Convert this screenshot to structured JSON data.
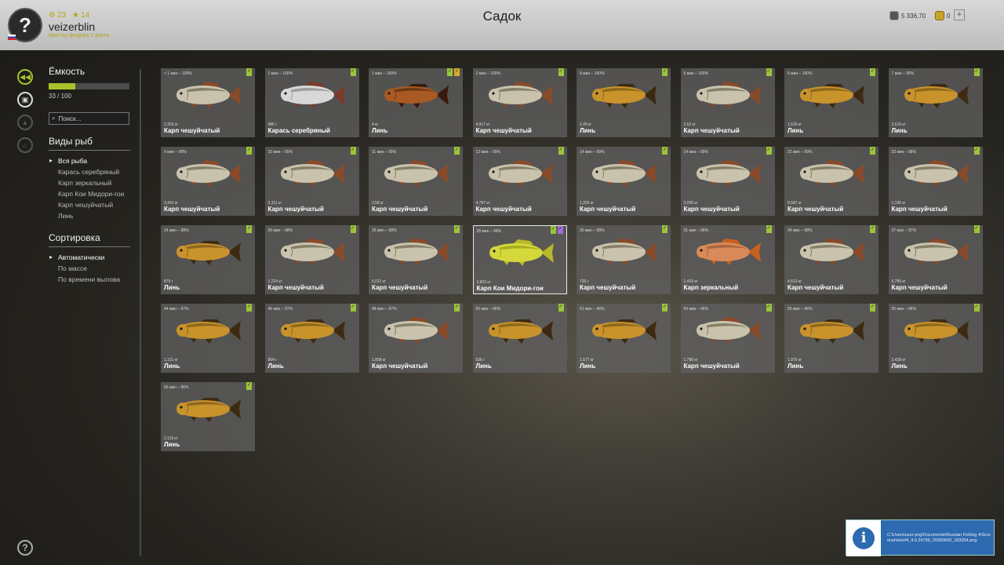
{
  "header": {
    "title": "Садок",
    "player": {
      "avatar_glyph": "?",
      "username": "veizerblin",
      "rank": "Мастер фидера 2 ранга",
      "stat1": "23",
      "stat2": "14"
    },
    "money": "5 336,70",
    "gold": "0",
    "plus_label": "+"
  },
  "rail_icons": [
    "keepnet-icon",
    "backpack-icon",
    "fire-icon",
    "home-icon"
  ],
  "sidebar": {
    "capacity_title": "Ёмкость",
    "capacity_text": "33 / 100",
    "capacity_fraction": 0.33,
    "search_placeholder": "Поиск...",
    "fish_types_title": "Виды рыб",
    "fish_types": [
      "Вся рыба",
      "Карась серебряный",
      "Карп зеркальный",
      "Карп Кои Мидори-гои",
      "Карп чешуйчатый",
      "Линь"
    ],
    "sort_title": "Сортировка",
    "sort_options": [
      "Автоматически",
      "По массе",
      "По времени вылова"
    ]
  },
  "help_label": "?",
  "colors": {
    "accent": "#a9c22a",
    "mark_green": "#9cc43a",
    "mark_gold": "#d7a92a",
    "mark_purple": "#a46ad8"
  },
  "fish": [
    {
      "time": "< 1 мин – 100%",
      "weight": "2,353 кг",
      "name": "Карп чешуйчатый",
      "kind": "carp",
      "marks": [
        "green"
      ]
    },
    {
      "time": "1 мин – 100%",
      "weight": "485 г",
      "name": "Карась серебряный",
      "kind": "crucian",
      "marks": [
        "green"
      ]
    },
    {
      "time": "1 мин – 100%",
      "weight": "4 кг",
      "name": "Линь",
      "kind": "tench-dark",
      "marks": [
        "green",
        "gold"
      ]
    },
    {
      "time": "2 мин – 100%",
      "weight": "4,917 кг",
      "name": "Карп чешуйчатый",
      "kind": "carp",
      "marks": [
        "green"
      ]
    },
    {
      "time": "4 мин – 100%",
      "weight": "1,49 кг",
      "name": "Линь",
      "kind": "tench",
      "marks": [
        "green"
      ]
    },
    {
      "time": "5 мин – 100%",
      "weight": "2,62 кг",
      "name": "Карп чешуйчатый",
      "kind": "carp",
      "marks": [
        "green"
      ]
    },
    {
      "time": "6 мин – 100%",
      "weight": "1,526 кг",
      "name": "Линь",
      "kind": "tench",
      "marks": [
        "green"
      ]
    },
    {
      "time": "7 мин – 99%",
      "weight": "2,619 кг",
      "name": "Линь",
      "kind": "tench",
      "marks": [
        "green"
      ]
    },
    {
      "time": "9 мин – 99%",
      "weight": "3,441 кг",
      "name": "Карп чешуйчатый",
      "kind": "carp",
      "marks": [
        "green"
      ]
    },
    {
      "time": "10 мин – 99%",
      "weight": "2,311 кг",
      "name": "Карп чешуйчатый",
      "kind": "carp",
      "marks": [
        "green"
      ]
    },
    {
      "time": "11 мин – 99%",
      "weight": "2,58 кг",
      "name": "Карп чешуйчатый",
      "kind": "carp",
      "marks": [
        "green"
      ]
    },
    {
      "time": "12 мин – 99%",
      "weight": "4,797 кг",
      "name": "Карп чешуйчатый",
      "kind": "carp",
      "marks": [
        "green"
      ]
    },
    {
      "time": "14 мин – 99%",
      "weight": "1,202 кг",
      "name": "Карп чешуйчатый",
      "kind": "carp",
      "marks": [
        "green"
      ]
    },
    {
      "time": "14 мин – 99%",
      "weight": "3,095 кг",
      "name": "Карп чешуйчатый",
      "kind": "carp",
      "marks": [
        "green"
      ]
    },
    {
      "time": "22 мин – 99%",
      "weight": "6,587 кг",
      "name": "Карп чешуйчатый",
      "kind": "carp",
      "marks": [
        "green"
      ]
    },
    {
      "time": "23 мин – 98%",
      "weight": "1,196 кг",
      "name": "Карп чешуйчатый",
      "kind": "carp",
      "marks": [
        "green"
      ]
    },
    {
      "time": "24 мин – 98%",
      "weight": "879 г",
      "name": "Линь",
      "kind": "tench",
      "marks": [
        "green"
      ]
    },
    {
      "time": "26 мин – 98%",
      "weight": "1,224 кг",
      "name": "Карп чешуйчатый",
      "kind": "carp",
      "marks": [
        "green"
      ]
    },
    {
      "time": "26 мин – 98%",
      "weight": "5,011 кг",
      "name": "Карп чешуйчатый",
      "kind": "carp",
      "marks": [
        "green"
      ]
    },
    {
      "time": "28 мин – 98%",
      "weight": "3,803 кг",
      "name": "Карп Кои Мидори-гои",
      "kind": "koi",
      "marks": [
        "green",
        "purple"
      ],
      "selected": true
    },
    {
      "time": "30 мин – 98%",
      "weight": "726 г",
      "name": "Карп чешуйчатый",
      "kind": "carp",
      "marks": [
        "green"
      ]
    },
    {
      "time": "31 мин – 98%",
      "weight": "1,433 кг",
      "name": "Карп зеркальный",
      "kind": "mirror",
      "marks": [
        "green"
      ]
    },
    {
      "time": "34 мин – 98%",
      "weight": "4,513 кг",
      "name": "Карп чешуйчатый",
      "kind": "carp",
      "marks": [
        "green"
      ]
    },
    {
      "time": "37 мин – 97%",
      "weight": "6,785 кг",
      "name": "Карп чешуйчатый",
      "kind": "carp",
      "marks": [
        "green"
      ]
    },
    {
      "time": "44 мин – 97%",
      "weight": "1,151 кг",
      "name": "Линь",
      "kind": "tench",
      "marks": [
        "green"
      ]
    },
    {
      "time": "46 мин – 97%",
      "weight": "964 г",
      "name": "Линь",
      "kind": "tench",
      "marks": [
        "green"
      ]
    },
    {
      "time": "48 мин – 97%",
      "weight": "1,808 кг",
      "name": "Карп чешуйчатый",
      "kind": "carp",
      "marks": [
        "green"
      ]
    },
    {
      "time": "50 мин – 96%",
      "weight": "636 г",
      "name": "Линь",
      "kind": "tench",
      "marks": [
        "green"
      ]
    },
    {
      "time": "51 мин – 96%",
      "weight": "1,577 кг",
      "name": "Линь",
      "kind": "tench",
      "marks": [
        "green"
      ]
    },
    {
      "time": "54 мин – 96%",
      "weight": "1,786 кг",
      "name": "Карп чешуйчатый",
      "kind": "carp",
      "marks": [
        "green"
      ]
    },
    {
      "time": "55 мин – 96%",
      "weight": "1,976 кг",
      "name": "Линь",
      "kind": "tench",
      "marks": [
        "green"
      ]
    },
    {
      "time": "55 мин – 96%",
      "weight": "2,428 кг",
      "name": "Линь",
      "kind": "tench",
      "marks": [
        "green"
      ]
    },
    {
      "time": "56 мин – 96%",
      "weight": "2,119 кг",
      "name": "Линь",
      "kind": "tench",
      "marks": [
        "green"
      ]
    }
  ],
  "fish_palette": {
    "carp": {
      "body": "#c9c3ad",
      "back": "#6f6a52",
      "fin": "#8a4a2a"
    },
    "crucian": {
      "body": "#d8d8d8",
      "back": "#8a8a8a",
      "fin": "#7a3a2a"
    },
    "tench": {
      "body": "#c9932c",
      "back": "#7a5a18",
      "fin": "#3e2a12"
    },
    "tench-dark": {
      "body": "#a85a22",
      "back": "#5a2e10",
      "fin": "#3a1a0c"
    },
    "koi": {
      "body": "#d4d83a",
      "back": "#9aa01a",
      "fin": "#b8b82a"
    },
    "mirror": {
      "body": "#d88a5a",
      "back": "#9a5a3a",
      "fin": "#c8601e"
    }
  },
  "toast": {
    "icon": "info-icon",
    "path": "C:\\Users\\user png\\Documents\\Russian Fishing 4\\Screenshots\\rf4_4.0.24799_20260606_183254.png"
  }
}
